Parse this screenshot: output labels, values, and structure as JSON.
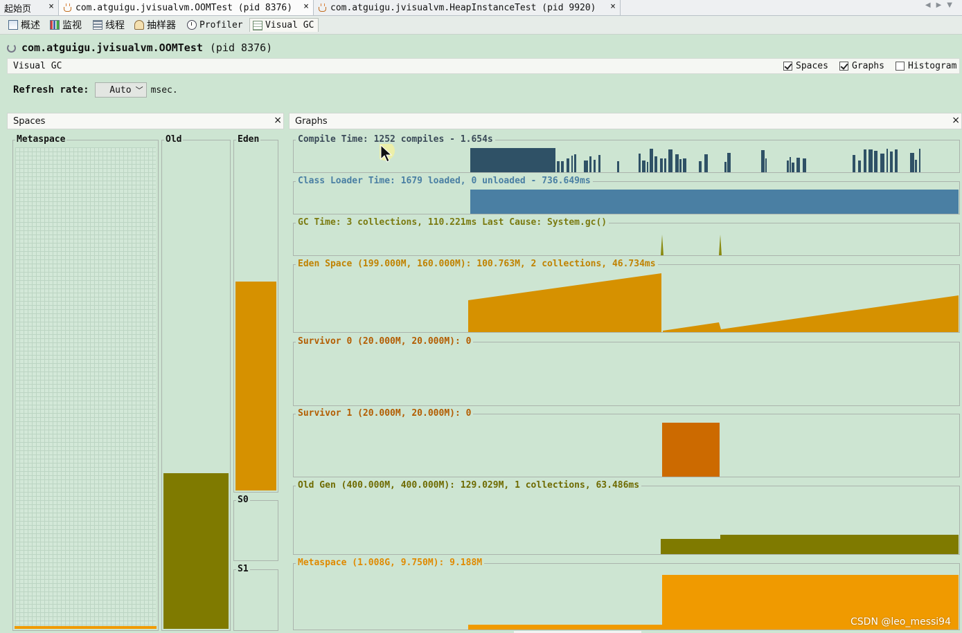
{
  "tabs": [
    {
      "label": "起始页",
      "close": "×"
    },
    {
      "label": "com.atguigu.jvisualvm.OOMTest (pid 8376)",
      "close": "×"
    },
    {
      "label": "com.atguigu.jvisualvm.HeapInstanceTest (pid 9920)",
      "close": "×"
    }
  ],
  "toolbar": {
    "overview": "概述",
    "monitor": "监视",
    "threads": "线程",
    "sampler": "抽样器",
    "profiler": "Profiler",
    "visual_gc": "Visual GC"
  },
  "page": {
    "app_name": "com.atguigu.jvisualvm.OOMTest",
    "pid": "(pid 8376)"
  },
  "visual_gc_header": {
    "title": "Visual GC",
    "spaces": {
      "label": "Spaces",
      "checked": true
    },
    "graphs": {
      "label": "Graphs",
      "checked": true
    },
    "histogram": {
      "label": "Histogram",
      "checked": false
    }
  },
  "refresh": {
    "label": "Refresh rate:",
    "value": "Auto",
    "unit": "msec."
  },
  "spaces_panel": {
    "title": "Spaces",
    "close": "×",
    "metaspace": {
      "label": "Metaspace",
      "fill_fraction": 0.005
    },
    "old": {
      "label": "Old",
      "fill_fraction": 0.32
    },
    "eden": {
      "label": "Eden",
      "fill_fraction": 0.6
    },
    "s0": {
      "label": "S0",
      "fill_fraction": 0
    },
    "s1": {
      "label": "S1",
      "fill_fraction": 0
    }
  },
  "graphs_panel": {
    "title": "Graphs",
    "close": "×",
    "compile": {
      "label": "Compile Time: 1252 compiles - 1.654s"
    },
    "classloader": {
      "label": "Class Loader Time: 1679 loaded, 0 unloaded - 736.649ms"
    },
    "gc": {
      "label": "GC Time: 3 collections, 110.221ms Last Cause: System.gc()"
    },
    "eden": {
      "label": "Eden Space (199.000M, 160.000M): 100.763M, 2 collections, 46.734ms"
    },
    "s0": {
      "label": "Survivor 0 (20.000M, 20.000M): 0"
    },
    "s1": {
      "label": "Survivor 1 (20.000M, 20.000M): 0"
    },
    "old": {
      "label": "Old Gen (400.000M, 400.000M): 129.029M, 1 collections, 63.486ms"
    },
    "meta": {
      "label": "Metaspace (1.008G, 9.750M): 9.188M"
    }
  },
  "colors": {
    "compile": "#2f5166",
    "classloader": "#4a7fa3",
    "gc": "#8a8a10",
    "eden": "#d69100",
    "survivor": "#cc6a00",
    "old": "#7f7a00",
    "metaspace": "#f09a00",
    "metaspace_label": "#e08a00"
  },
  "watermark": "CSDN @leo_messi94"
}
